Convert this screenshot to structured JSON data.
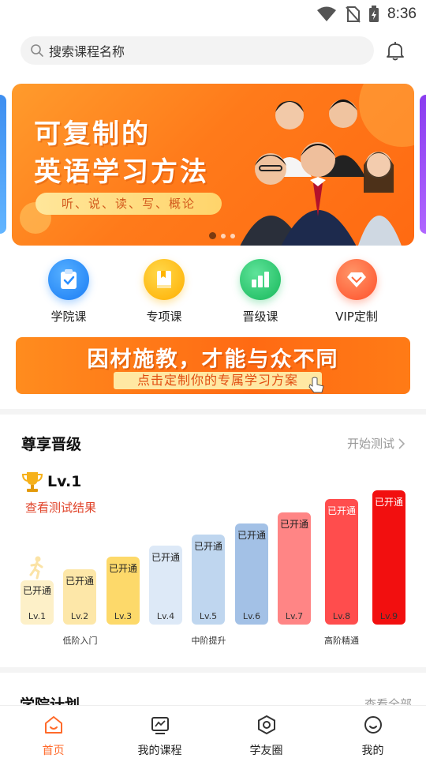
{
  "status_bar": {
    "time": "8:36"
  },
  "search": {
    "placeholder": "搜索课程名称"
  },
  "carousel": {
    "title_line1": "可复制的",
    "title_line2": "英语学习方法",
    "subtitle": "听、说、读、写、概论"
  },
  "categories": [
    {
      "label": "学院课",
      "color": "#2b8fff"
    },
    {
      "label": "专项课",
      "color": "#ffb400"
    },
    {
      "label": "晋级课",
      "color": "#2ccf6d"
    },
    {
      "label": "VIP定制",
      "color": "#ff6a3a"
    }
  ],
  "promo": {
    "title": "因材施教，才能与众不同",
    "subtitle": "点击定制你的专属学习方案"
  },
  "level_section": {
    "title": "尊享晋级",
    "more": "开始测试",
    "current_level": "Lv.1",
    "result_link": "查看测试结果",
    "levels": [
      {
        "status": "已开通",
        "label": "Lv.1",
        "color": "#fdf0c8"
      },
      {
        "status": "已开通",
        "label": "Lv.2",
        "color": "#fde7a8"
      },
      {
        "status": "已开通",
        "label": "Lv.3",
        "color": "#fdd96a"
      },
      {
        "status": "已开通",
        "label": "Lv.4",
        "color": "#dde9f7"
      },
      {
        "status": "已开通",
        "label": "Lv.5",
        "color": "#bfd6ef"
      },
      {
        "status": "已开通",
        "label": "Lv.6",
        "color": "#a3c1e6"
      },
      {
        "status": "已开通",
        "label": "Lv.7",
        "color": "#ff8585"
      },
      {
        "status": "已开通",
        "label": "Lv.8",
        "color": "#ff4d4d"
      },
      {
        "status": "已开通",
        "label": "Lv.9",
        "color": "#f20f0f"
      }
    ],
    "bands": [
      {
        "label": "低阶入门",
        "color": "#fbe2a8"
      },
      {
        "label": "中阶提升",
        "color": "#bccbe2"
      },
      {
        "label": "高阶精通",
        "color": "#f6c8c4"
      }
    ]
  },
  "section2": {
    "title": "学院计划",
    "more": "查看全部"
  },
  "bottom_nav": [
    {
      "label": "首页",
      "active": true
    },
    {
      "label": "我的课程",
      "active": false
    },
    {
      "label": "学友圈",
      "active": false
    },
    {
      "label": "我的",
      "active": false
    }
  ],
  "colors": {
    "accent": "#ff6a2a",
    "banner": "#ff7a1a",
    "link": "#e0442a"
  }
}
